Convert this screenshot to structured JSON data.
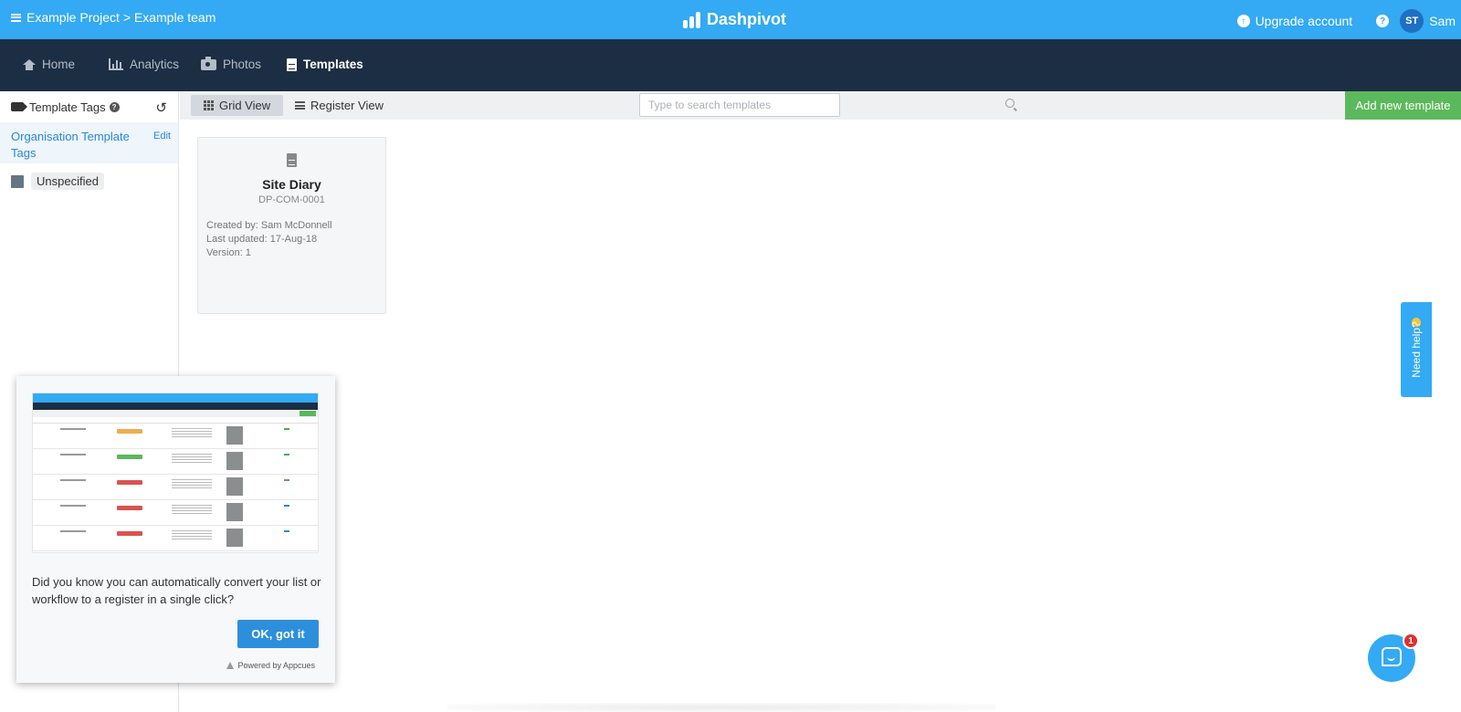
{
  "topbar": {
    "breadcrumb": "Example Project > Example team",
    "brand": "Dashpivot",
    "upgrade_label": "Upgrade account",
    "help_glyph": "?",
    "avatar_initials": "ST",
    "user_name": "Sam"
  },
  "nav": {
    "items": [
      {
        "label": "Home",
        "icon": "home-icon"
      },
      {
        "label": "Analytics",
        "icon": "bar-chart-icon"
      },
      {
        "label": "Photos",
        "icon": "camera-icon"
      },
      {
        "label": "Templates",
        "icon": "document-icon",
        "active": true
      }
    ]
  },
  "sidebar": {
    "title": "Template Tags",
    "org_tags_label": "Organisation Template Tags",
    "edit_label": "Edit",
    "tags": [
      {
        "label": "Unspecified",
        "color": "#657683"
      }
    ]
  },
  "toolbar": {
    "grid_view_label": "Grid View",
    "register_view_label": "Register View",
    "search_placeholder": "Type to search templates",
    "add_button_label": "Add new template"
  },
  "templates": [
    {
      "title": "Site Diary",
      "code": "DP-COM-0001",
      "created_by": "Created by: Sam McDonnell",
      "last_updated": "Last updated: 17-Aug-18",
      "version": "Version: 1"
    }
  ],
  "popup": {
    "message": "Did you know you can automatically convert your list or workflow to a register in a single click?",
    "ok_label": "OK, got it",
    "powered_by": "Powered by Appcues"
  },
  "help_tab": {
    "label": "Need help?"
  },
  "chat": {
    "unread_count": "1"
  },
  "colors": {
    "topbar": "#33aaf3",
    "navbar": "#1c2e43",
    "add_button": "#5cb85c",
    "link": "#2a87d8",
    "badge": "#e0302d"
  }
}
